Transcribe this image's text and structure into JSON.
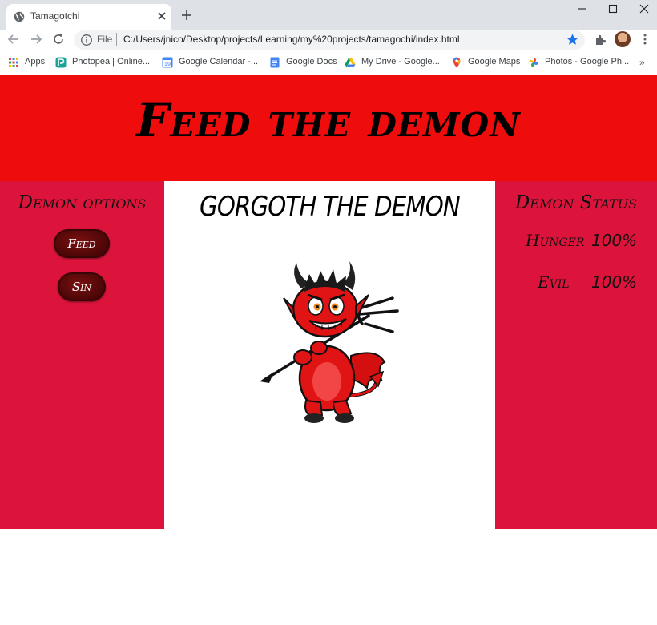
{
  "browser": {
    "tab_title": "Tamagotchi",
    "url_scheme": "File",
    "url": "C:/Users/jnico/Desktop/projects/Learning/my%20projects/tamagochi/index.html",
    "bookmarks": [
      {
        "label": "Apps",
        "icon": "apps-grid-icon"
      },
      {
        "label": "Photopea | Online...",
        "icon": "photopea-icon"
      },
      {
        "label": "Google Calendar -...",
        "icon": "calendar-icon"
      },
      {
        "label": "Google Docs",
        "icon": "docs-icon"
      },
      {
        "label": "My Drive - Google...",
        "icon": "drive-icon"
      },
      {
        "label": "Google Maps",
        "icon": "maps-icon"
      },
      {
        "label": "Photos - Google Ph...",
        "icon": "photos-icon"
      }
    ],
    "overflow": "»"
  },
  "page": {
    "header_title": "Feed the demon",
    "colors": {
      "header": "#ee0c0c",
      "panels": "#dc143c",
      "button": "#5a0808"
    }
  },
  "left_panel": {
    "title": "Demon options",
    "buttons": [
      {
        "label": "Feed"
      },
      {
        "label": "Sin"
      }
    ]
  },
  "center_panel": {
    "demon_name": "GORGOTH THE DEMON",
    "image": "cartoon-red-devil-with-trident"
  },
  "right_panel": {
    "title": "Demon Status",
    "stats": [
      {
        "label": "Hunger",
        "value": "100%"
      },
      {
        "label": "Evil",
        "value": "100%"
      }
    ]
  }
}
